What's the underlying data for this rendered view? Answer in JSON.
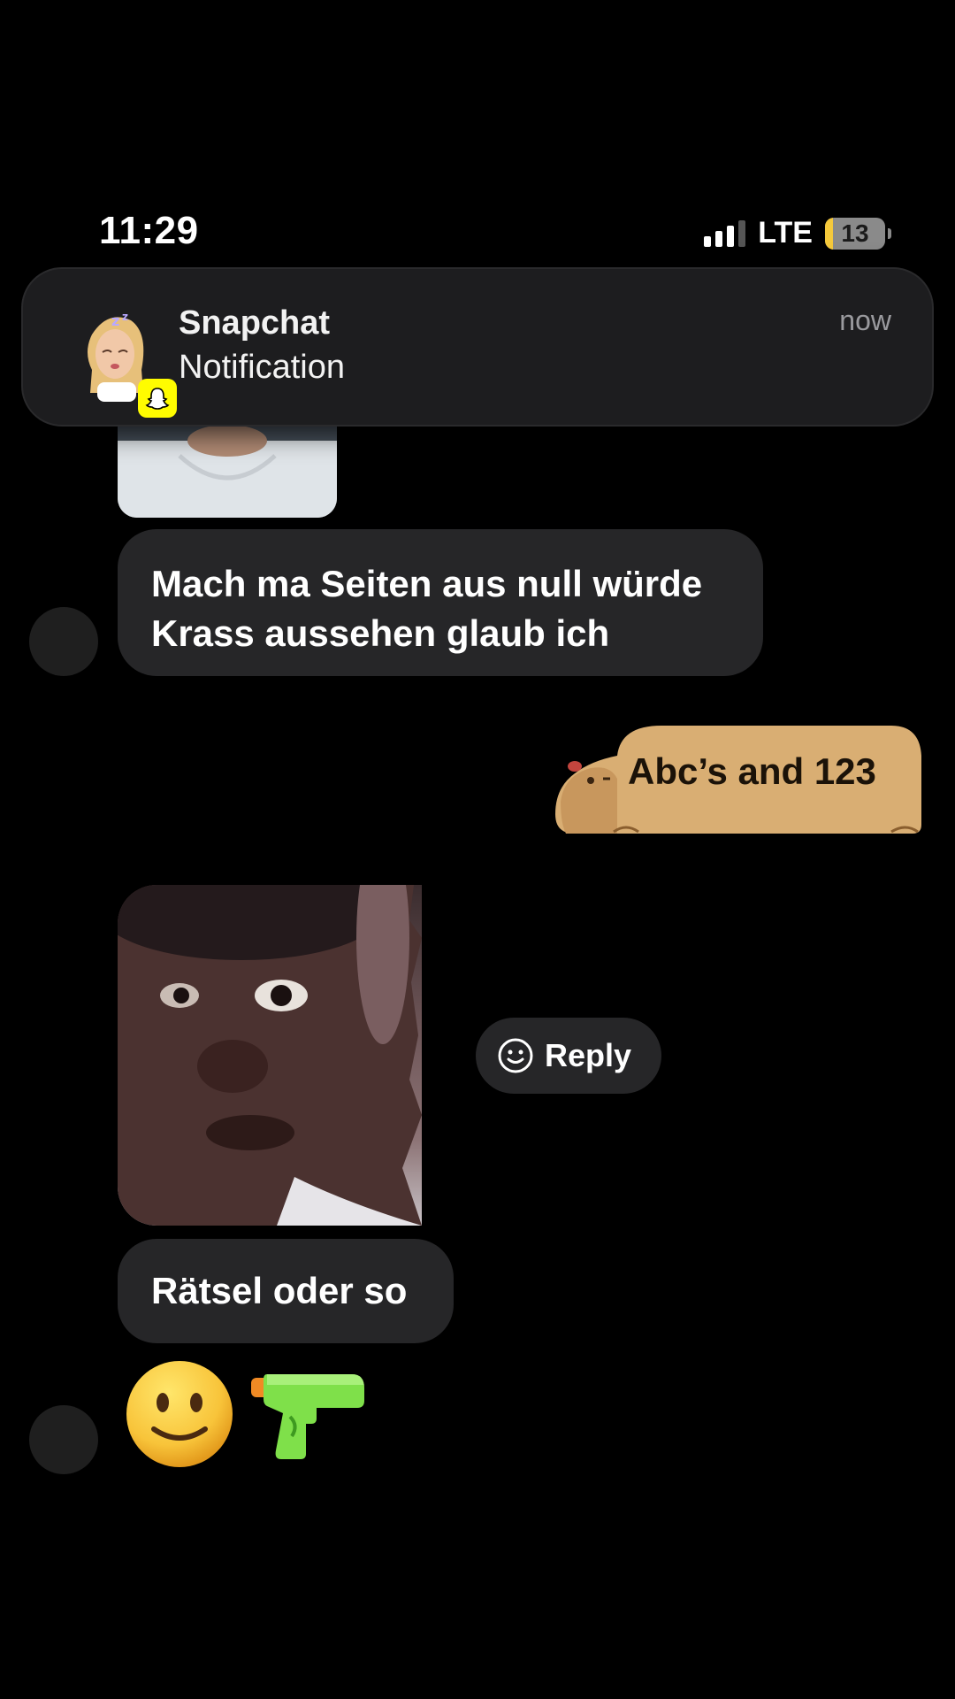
{
  "status_bar": {
    "time": "11:29",
    "network": "LTE",
    "battery_level": "13",
    "battery_fraction": 0.13
  },
  "notification": {
    "app_name": "Snapchat",
    "body": "Notification",
    "time": "now",
    "avatar_badge_icon": "snapchat-ghost-icon"
  },
  "messages": [
    {
      "type": "image",
      "from": "them"
    },
    {
      "type": "text",
      "from": "them",
      "lines": [
        "Mach ma Seiten aus null würde",
        "Krass aussehen glaub ich"
      ]
    },
    {
      "type": "sticker",
      "from": "me",
      "text": "Abc’s and 123",
      "sticker_icon": "capybara-icon"
    },
    {
      "type": "image",
      "from": "them"
    },
    {
      "type": "text",
      "from": "them",
      "text": "Rätsel oder so"
    },
    {
      "type": "emoji",
      "from": "them",
      "emojis": [
        "slightly-smiling-face-icon",
        "water-pistol-icon"
      ]
    }
  ],
  "reply_button": {
    "label": "Reply",
    "icon": "smiley-outline-icon"
  },
  "colors": {
    "background": "#000000",
    "bubble": "#262628",
    "sticker_fill": "#d9ae73",
    "snapchat_yellow": "#fffc00",
    "battery_yellow": "#f5c93b"
  }
}
